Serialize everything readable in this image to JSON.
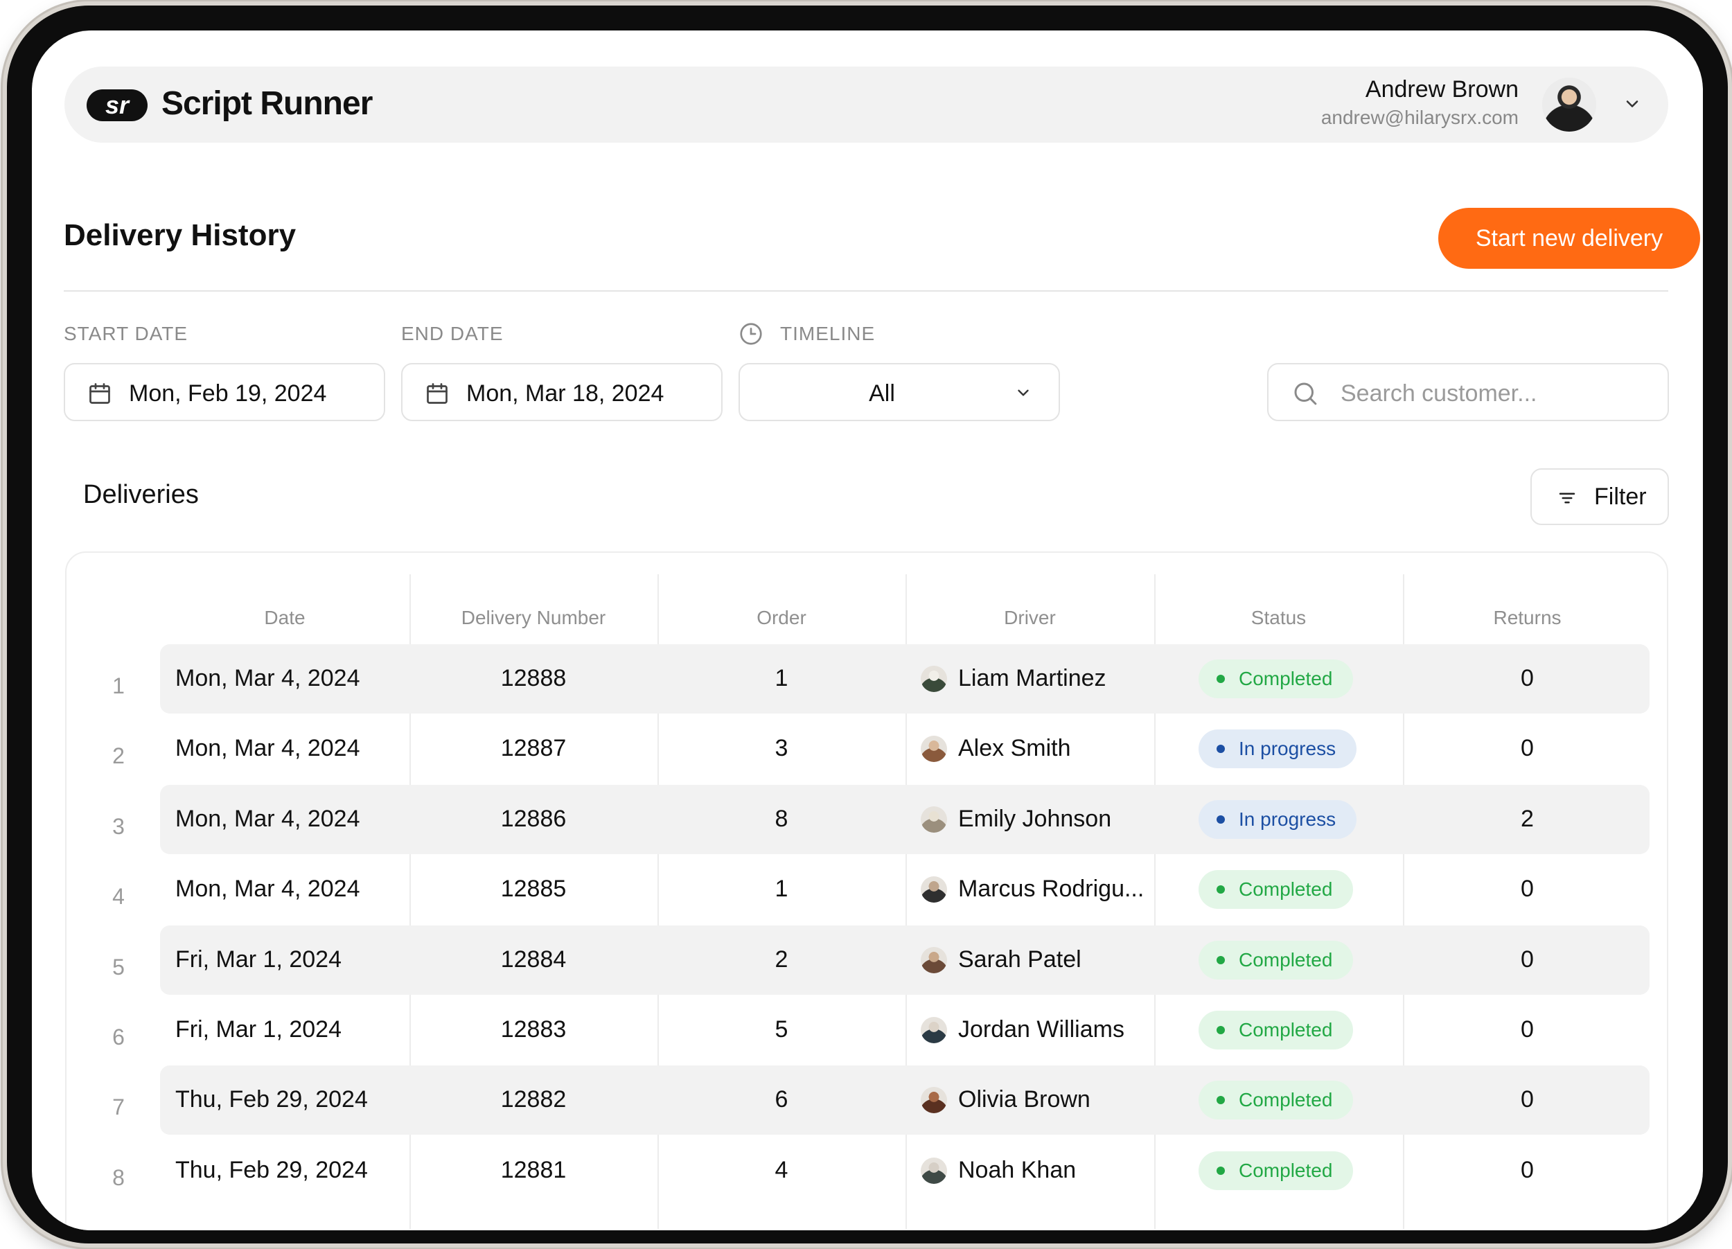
{
  "app": {
    "logo_badge": "sr",
    "name": "Script Runner"
  },
  "user": {
    "name": "Andrew Brown",
    "email": "andrew@hilarysrx.com"
  },
  "page": {
    "title": "Delivery History",
    "primary_action": "Start new delivery"
  },
  "filters": {
    "start_date": {
      "label": "START DATE",
      "value": "Mon, Feb 19, 2024"
    },
    "end_date": {
      "label": "END DATE",
      "value": "Mon, Mar 18, 2024"
    },
    "timeline": {
      "label": "TIMELINE",
      "value": "All"
    },
    "search": {
      "placeholder": "Search customer..."
    }
  },
  "deliveries": {
    "title": "Deliveries",
    "filter_label": "Filter",
    "columns": [
      "Date",
      "Delivery Number",
      "Order",
      "Driver",
      "Status",
      "Returns"
    ],
    "rows": [
      {
        "index": "1",
        "date": "Mon, Mar 4, 2024",
        "number": "12888",
        "order": "1",
        "driver": "Liam Martinez",
        "status": "Completed",
        "returns": "0"
      },
      {
        "index": "2",
        "date": "Mon, Mar 4, 2024",
        "number": "12887",
        "order": "3",
        "driver": "Alex Smith",
        "status": "In progress",
        "returns": "0"
      },
      {
        "index": "3",
        "date": "Mon, Mar 4, 2024",
        "number": "12886",
        "order": "8",
        "driver": "Emily Johnson",
        "status": "In progress",
        "returns": "2"
      },
      {
        "index": "4",
        "date": "Mon, Mar 4, 2024",
        "number": "12885",
        "order": "1",
        "driver": "Marcus Rodrigu...",
        "status": "Completed",
        "returns": "0"
      },
      {
        "index": "5",
        "date": "Fri, Mar 1, 2024",
        "number": "12884",
        "order": "2",
        "driver": "Sarah Patel",
        "status": "Completed",
        "returns": "0"
      },
      {
        "index": "6",
        "date": "Fri, Mar 1, 2024",
        "number": "12883",
        "order": "5",
        "driver": "Jordan Williams",
        "status": "Completed",
        "returns": "0"
      },
      {
        "index": "7",
        "date": "Thu, Feb 29, 2024",
        "number": "12882",
        "order": "6",
        "driver": "Olivia Brown",
        "status": "Completed",
        "returns": "0"
      },
      {
        "index": "8",
        "date": "Thu, Feb 29, 2024",
        "number": "12881",
        "order": "4",
        "driver": "Noah Khan",
        "status": "Completed",
        "returns": "0"
      }
    ]
  },
  "colors": {
    "accent": "#ff6a13",
    "completed": "#22a845",
    "in_progress": "#1c4fa3"
  },
  "icons": {
    "date_field": "calendar-icon",
    "timeline": "clock-icon",
    "search": "search-icon",
    "filter": "filter-lines-icon",
    "dropdown": "chevron-down-icon"
  }
}
